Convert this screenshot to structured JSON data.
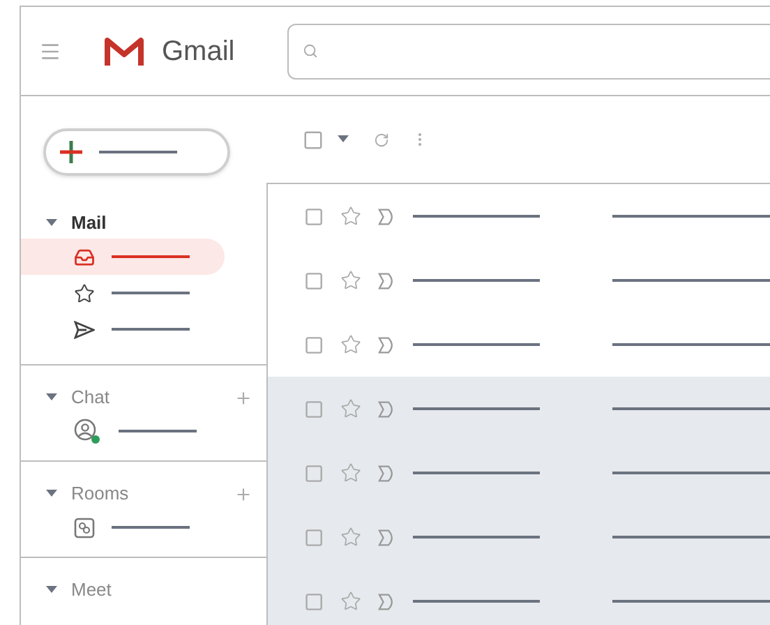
{
  "header": {
    "title": "Gmail"
  },
  "sidebar": {
    "sections": [
      {
        "label": "Mail",
        "expanded": true,
        "add_button": false,
        "items": [
          {
            "kind": "inbox",
            "selected": true
          },
          {
            "kind": "star",
            "selected": false
          },
          {
            "kind": "send",
            "selected": false
          }
        ]
      },
      {
        "label": "Chat",
        "expanded": true,
        "add_button": true,
        "items": [
          {
            "kind": "person",
            "selected": false
          }
        ]
      },
      {
        "label": "Rooms",
        "expanded": true,
        "add_button": true,
        "items": [
          {
            "kind": "room",
            "selected": false
          }
        ]
      },
      {
        "label": "Meet",
        "expanded": true,
        "add_button": false
      }
    ]
  },
  "toolbar": {
    "select_all": {
      "checked": false
    }
  },
  "messages": [
    {
      "read": false
    },
    {
      "read": false
    },
    {
      "read": false
    },
    {
      "read": true
    },
    {
      "read": true
    },
    {
      "read": true
    },
    {
      "read": true
    }
  ]
}
